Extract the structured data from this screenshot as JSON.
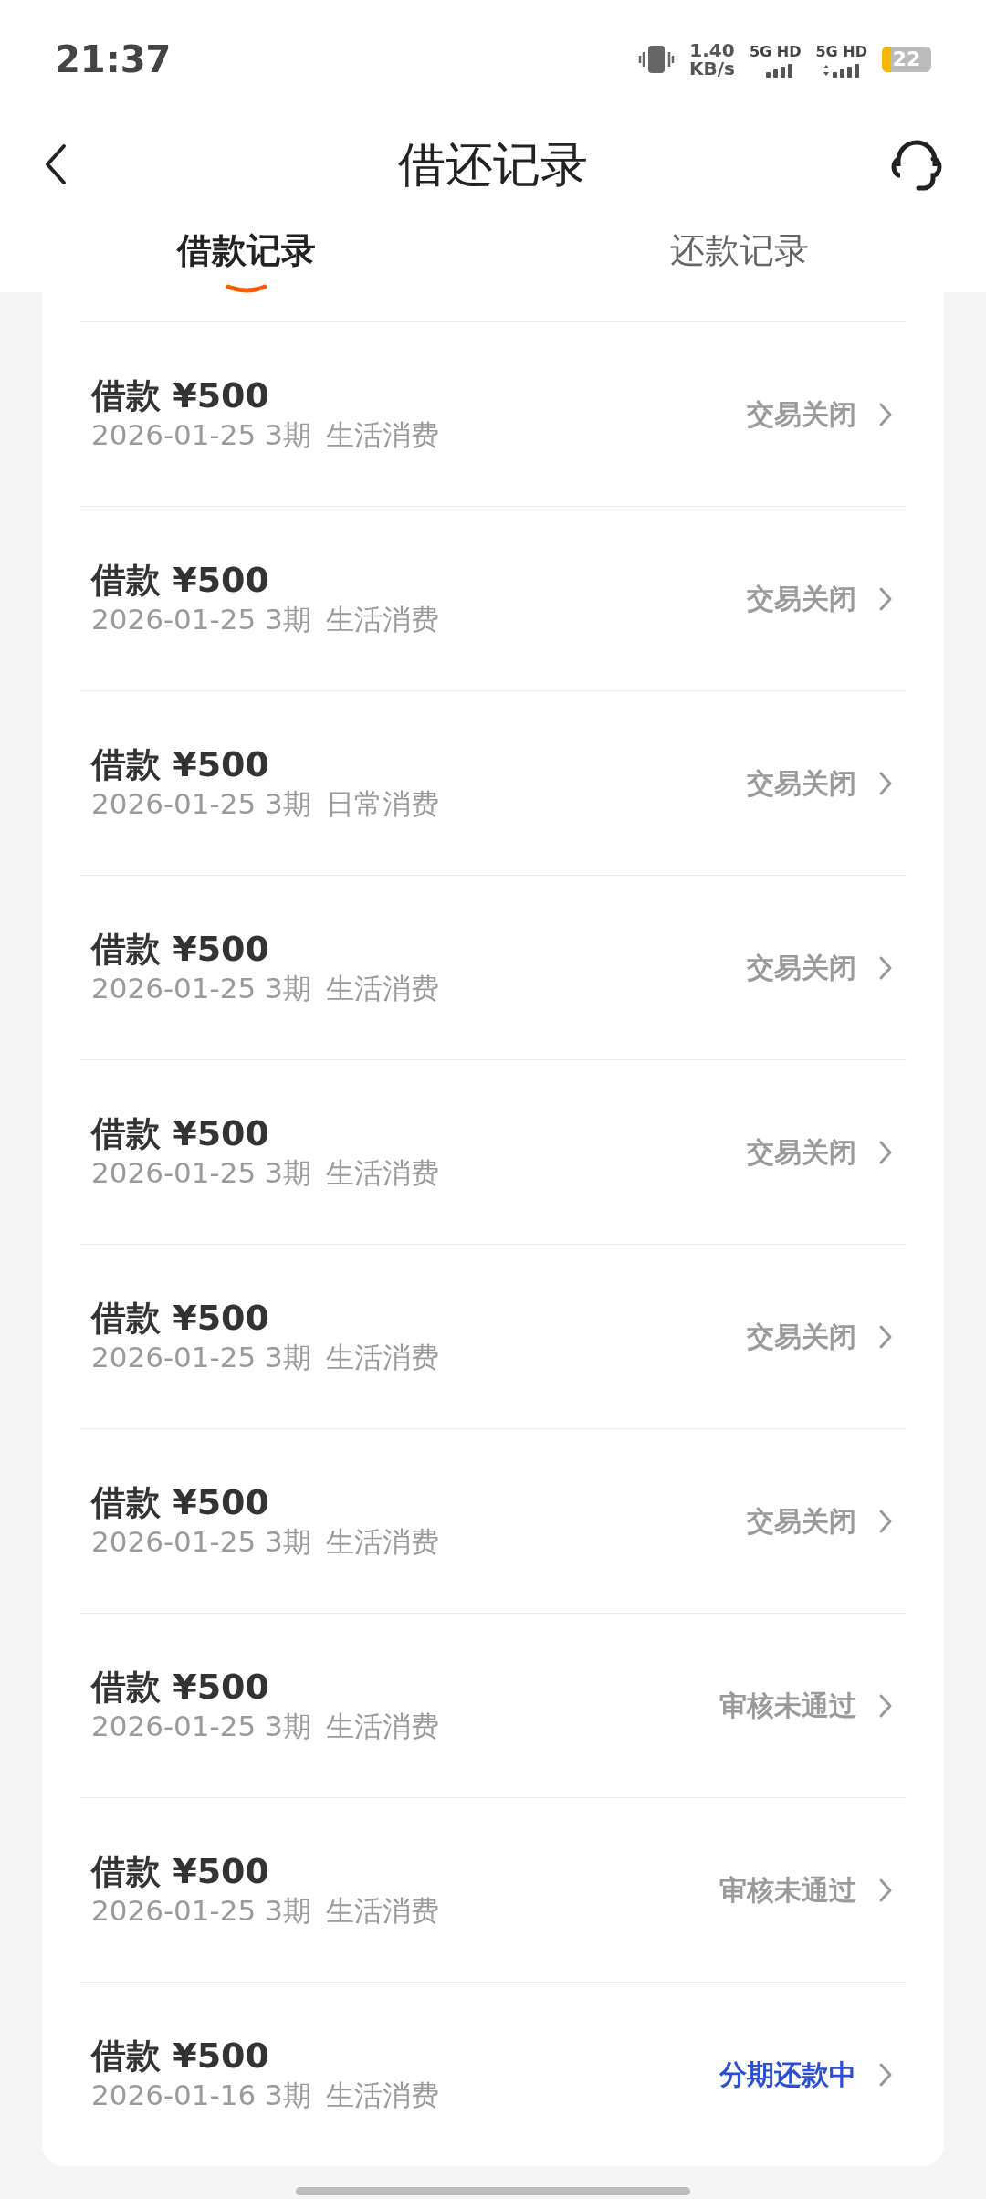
{
  "status_bar": {
    "time": "21:37",
    "speed": "1.40",
    "speed_unit": "KB/s",
    "networks": [
      "5G HD",
      "5G HD"
    ],
    "battery": "22"
  },
  "header": {
    "title": "借还记录"
  },
  "tabs": [
    {
      "label": "借款记录",
      "selected": true
    },
    {
      "label": "还款记录",
      "selected": false
    }
  ],
  "records": [
    {
      "title": "借款 ¥500",
      "info": "2026-01-25 3期",
      "purpose": "生活消费",
      "status": "交易关闭",
      "kind": "closed"
    },
    {
      "title": "借款 ¥500",
      "info": "2026-01-25 3期",
      "purpose": "生活消费",
      "status": "交易关闭",
      "kind": "closed"
    },
    {
      "title": "借款 ¥500",
      "info": "2026-01-25 3期",
      "purpose": "日常消费",
      "status": "交易关闭",
      "kind": "closed"
    },
    {
      "title": "借款 ¥500",
      "info": "2026-01-25 3期",
      "purpose": "生活消费",
      "status": "交易关闭",
      "kind": "closed"
    },
    {
      "title": "借款 ¥500",
      "info": "2026-01-25 3期",
      "purpose": "生活消费",
      "status": "交易关闭",
      "kind": "closed"
    },
    {
      "title": "借款 ¥500",
      "info": "2026-01-25 3期",
      "purpose": "生活消费",
      "status": "交易关闭",
      "kind": "closed"
    },
    {
      "title": "借款 ¥500",
      "info": "2026-01-25 3期",
      "purpose": "生活消费",
      "status": "交易关闭",
      "kind": "closed"
    },
    {
      "title": "借款 ¥500",
      "info": "2026-01-25 3期",
      "purpose": "生活消费",
      "status": "审核未通过",
      "kind": "rejected"
    },
    {
      "title": "借款 ¥500",
      "info": "2026-01-25 3期",
      "purpose": "生活消费",
      "status": "审核未通过",
      "kind": "rejected"
    },
    {
      "title": "借款 ¥500",
      "info": "2026-01-16 3期",
      "purpose": "生活消费",
      "status": "分期还款中",
      "kind": "repaying"
    }
  ]
}
